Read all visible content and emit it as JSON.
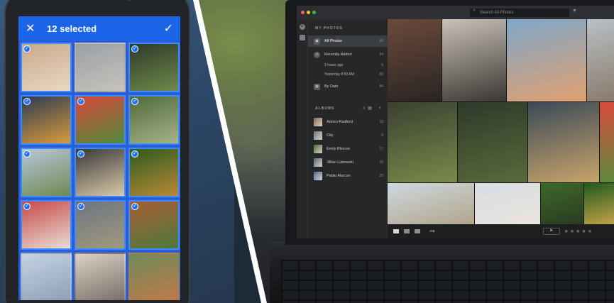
{
  "phone": {
    "selection_bar": {
      "close_icon": "close-icon",
      "count_label": "12 selected",
      "confirm_icon": "check-icon"
    },
    "tiles": [
      {
        "selected": true,
        "colors": [
          "#c9a98a",
          "#e9d8c2"
        ]
      },
      {
        "selected": false,
        "colors": [
          "#9aa0a6",
          "#c7c3bb"
        ]
      },
      {
        "selected": true,
        "colors": [
          "#2e3a2a",
          "#6f8a4a"
        ]
      },
      {
        "selected": true,
        "colors": [
          "#2d3c52",
          "#d99a3c"
        ]
      },
      {
        "selected": true,
        "colors": [
          "#d9473b",
          "#4d8c3a"
        ]
      },
      {
        "selected": true,
        "colors": [
          "#4f6b3a",
          "#a7b38a"
        ]
      },
      {
        "selected": true,
        "colors": [
          "#b8c6d8",
          "#6e8a52"
        ]
      },
      {
        "selected": true,
        "colors": [
          "#3a3a3a",
          "#d9c9a8"
        ]
      },
      {
        "selected": true,
        "colors": [
          "#2f5a1e",
          "#b88a36"
        ]
      },
      {
        "selected": true,
        "colors": [
          "#c94a46",
          "#e9ddd6"
        ]
      },
      {
        "selected": true,
        "colors": [
          "#6c7480",
          "#a39a7e"
        ]
      },
      {
        "selected": true,
        "colors": [
          "#a85d35",
          "#4e7a3c"
        ]
      },
      {
        "selected": false,
        "colors": [
          "#c5d3e3",
          "#8da0b6"
        ]
      },
      {
        "selected": false,
        "colors": [
          "#d9d2c6",
          "#7a6f66"
        ]
      },
      {
        "selected": false,
        "colors": [
          "#6f8a5a",
          "#c07a48"
        ]
      }
    ]
  },
  "app": {
    "search_placeholder": "Search All Photos",
    "sidebar": {
      "my_photos_header": "MY PHOTOS",
      "all_photos": {
        "label": "All Photos",
        "count": "84"
      },
      "recently_added": {
        "label": "Recently Added",
        "count": "34"
      },
      "recent_subitems": [
        {
          "label": "2 hours ago",
          "count": "6"
        },
        {
          "label": "Yesterday 8:53 AM",
          "count": "82"
        }
      ],
      "by_date": {
        "label": "By Date",
        "count": "84"
      },
      "albums_header": "ALBUMS",
      "albums": [
        {
          "label": "Adrien Radford",
          "count": "19",
          "color": "#8a6a52"
        },
        {
          "label": "City",
          "count": "6",
          "color": "#6c7480"
        },
        {
          "label": "Emily Blincoe",
          "count": "17",
          "color": "#4f6b3a"
        },
        {
          "label": "Jillian Lukowski",
          "count": "10",
          "color": "#5a6a7a"
        },
        {
          "label": "Pablo Alarcon",
          "count": "20",
          "color": "#4a6a9a"
        }
      ]
    },
    "bottombar": {
      "stars": "★★★★★"
    },
    "photos": [
      {
        "colors": [
          "#6a4a3a",
          "#2a2422"
        ]
      },
      {
        "colors": [
          "#c8c2b8",
          "#3a3632"
        ]
      },
      {
        "colors": [
          "#7fa7c9",
          "#e0a070"
        ]
      },
      {
        "colors": [
          "#b8c0c6",
          "#8a7a6a"
        ]
      },
      {
        "colors": [
          "#3a4030",
          "#7a8a4a"
        ]
      },
      {
        "colors": [
          "#2c3a2a",
          "#5a6a3a"
        ]
      },
      {
        "colors": [
          "#3a4a58",
          "#c9a46a"
        ]
      },
      {
        "colors": [
          "#d94a3a",
          "#5a8c3a"
        ]
      },
      {
        "colors": [
          "#cfd8de",
          "#b0a58c"
        ]
      },
      {
        "colors": [
          "#d8dde2",
          "#e9e4de"
        ]
      },
      {
        "colors": [
          "#3c6a2a",
          "#2a3a22"
        ]
      },
      {
        "colors": [
          "#1f5a1c",
          "#c4a24a"
        ]
      }
    ]
  }
}
